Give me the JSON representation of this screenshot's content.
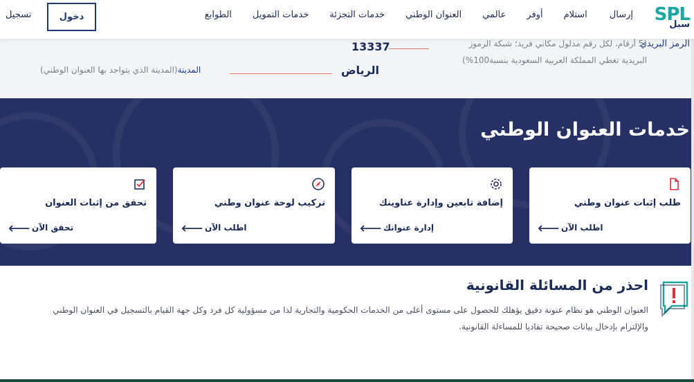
{
  "header": {
    "logo_text": "SPL",
    "logo_ar": "سبل",
    "nav": [
      "إرسال",
      "استلام",
      "أوفر",
      "عالمي",
      "العنوان الوطني",
      "خدمات التجزئة",
      "خدمات التمويل",
      "الطوابع"
    ],
    "login_label": "دخول",
    "register_label": "تسجيل"
  },
  "info": {
    "zip_label": "الرمز البريدي",
    "zip_desc_line1": "(5 أرقام، لكل رقم مدلول مكاني فريد؛ شبكة الرموز",
    "zip_desc_line2": "البريدية تغطي المملكة العربية السعودية بنسبة100%)",
    "zip_value": "13337",
    "city_value": "الرياض",
    "city_label": "المدينة",
    "city_desc": "(المدينة الذي يتواجد بها العنوان الوطني)"
  },
  "services": {
    "title": "خدمات العنوان الوطني",
    "cards": [
      {
        "title": "طلب إثبات عنوان وطني",
        "link": "اطلب الآن",
        "icon": "document-icon"
      },
      {
        "title": "إضافة تابعين وإدارة عناوينك",
        "link": "إدارة عنوانك",
        "icon": "gear-icon"
      },
      {
        "title": "تركيب لوحة عنوان وطني",
        "link": "اطلب الآن",
        "icon": "compass-icon"
      },
      {
        "title": "تحقق من إثبات العنوان",
        "link": "تحقق الآن",
        "icon": "checkbox-icon"
      }
    ]
  },
  "warning": {
    "title": "احذر من المسائلة القانونية",
    "text": "العنوان الوطني هو نظام عنونة دقيق يؤهلك للحصول على مستوى أعلى من الخدمات الحكومية والتجارية لذا من مسؤولية كل فرد وكل جهة القيام بالتسجيل في العنوان الوطني والإلتزام بإدخال بيانات صحيحة تفاديا للمساءلة القانونية."
  },
  "colors": {
    "navy": "#263064",
    "teal": "#1aa7a1",
    "accent_red": "#e0303a",
    "line_orange": "#e07a5f"
  }
}
